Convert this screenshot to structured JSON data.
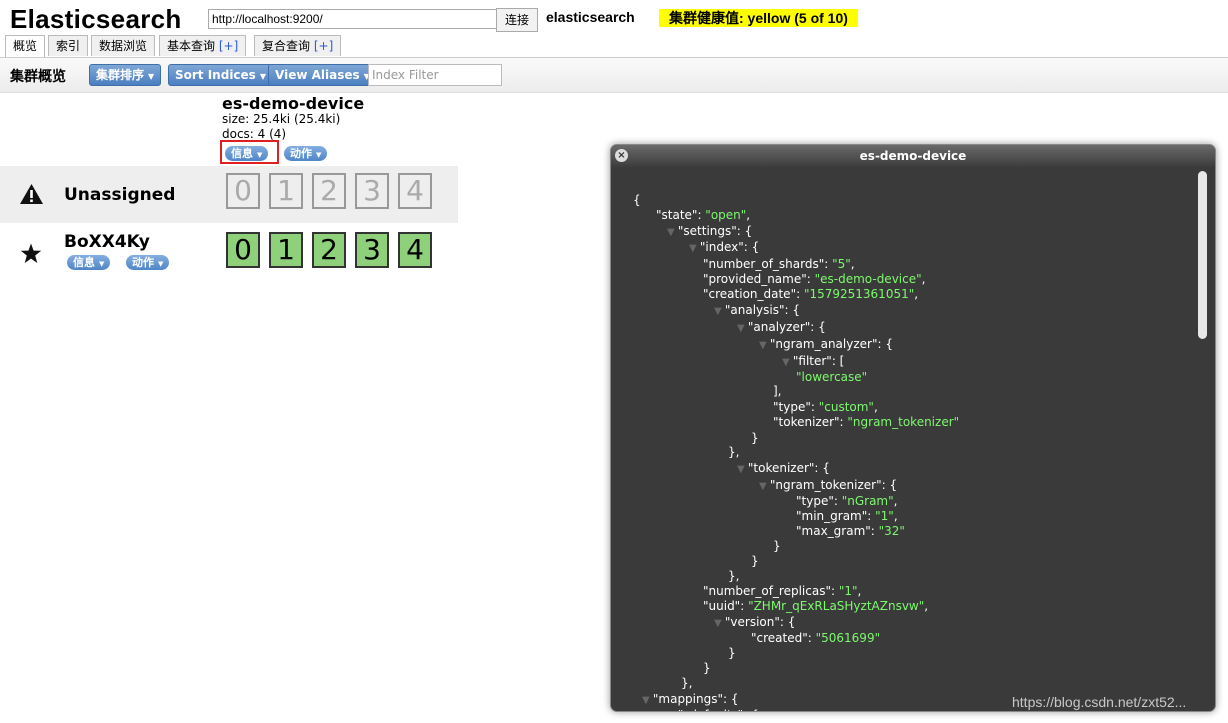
{
  "header": {
    "brand": "Elasticsearch",
    "url_value": "http://localhost:9200/",
    "connect_label": "连接",
    "cluster_name": "elasticsearch",
    "health_text": "集群健康值: yellow (5 of 10)",
    "health_color": "#ffff00"
  },
  "tabs": [
    {
      "label": "概览",
      "plus": ""
    },
    {
      "label": "索引",
      "plus": ""
    },
    {
      "label": "数据浏览",
      "plus": ""
    },
    {
      "label": "基本查询 ",
      "plus": "[+]"
    },
    {
      "label": "复合查询 ",
      "plus": "[+]"
    }
  ],
  "toolbar": {
    "title": "集群概览",
    "sort_cluster_label": "集群排序",
    "sort_indices_label": "Sort Indices",
    "view_aliases_label": "View Aliases",
    "filter_placeholder": "Index Filter"
  },
  "index": {
    "name": "es-demo-device",
    "size": "size: 25.4ki (25.4ki)",
    "docs": "docs: 4 (4)",
    "info_label": "信息",
    "actions_label": "动作"
  },
  "nodes": {
    "unassigned": {
      "label": "Unassigned",
      "shards": [
        "0",
        "1",
        "2",
        "3",
        "4"
      ]
    },
    "node": {
      "label": "BoXX4Ky",
      "info_label": "信息",
      "actions_label": "动作",
      "shards": [
        "0",
        "1",
        "2",
        "3",
        "4"
      ]
    }
  },
  "modal": {
    "title": "es-demo-device",
    "json_lines": [
      {
        "t": "{"
      },
      {
        "k": "\"state\"",
        "v": "\"open\"",
        "e": ","
      },
      {
        "tri": true,
        "k": "\"settings\"",
        "e": ": {"
      },
      {
        "tri": true,
        "k": "\"index\"",
        "e": ": {"
      },
      {
        "k": "\"number_of_shards\"",
        "v": "\"5\"",
        "e": ","
      },
      {
        "k": "\"provided_name\"",
        "v": "\"es-demo-device\"",
        "e": ","
      },
      {
        "k": "\"creation_date\"",
        "v": "\"1579251361051\"",
        "e": ","
      },
      {
        "tri": true,
        "k": "\"analysis\"",
        "e": ": {"
      },
      {
        "tri": true,
        "k": "\"analyzer\"",
        "e": ": {"
      },
      {
        "tri": true,
        "k": "\"ngram_analyzer\"",
        "e": ": {"
      },
      {
        "tri": true,
        "k": "\"filter\"",
        "e": ": ["
      },
      {
        "s": "\"lowercase\""
      },
      {
        "t": "],"
      },
      {
        "k": "\"type\"",
        "v": "\"custom\"",
        "e": ","
      },
      {
        "k": "\"tokenizer\"",
        "v": "\"ngram_tokenizer\"",
        "e": ""
      },
      {
        "t": "}"
      },
      {
        "t": "},"
      },
      {
        "tri": true,
        "k": "\"tokenizer\"",
        "e": ": {"
      },
      {
        "tri": true,
        "k": "\"ngram_tokenizer\"",
        "e": ": {"
      },
      {
        "k": "\"type\"",
        "v": "\"nGram\"",
        "e": ","
      },
      {
        "k": "\"min_gram\"",
        "v": "\"1\"",
        "e": ","
      },
      {
        "k": "\"max_gram\"",
        "v": "\"32\"",
        "e": ""
      },
      {
        "t": "}"
      },
      {
        "t": "}"
      },
      {
        "t": "},"
      },
      {
        "k": "\"number_of_replicas\"",
        "v": "\"1\"",
        "e": ","
      },
      {
        "k": "\"uuid\"",
        "v": "\"ZHMr_qExRLaSHyztAZnsvw\"",
        "e": ","
      },
      {
        "tri": true,
        "k": "\"version\"",
        "e": ": {"
      },
      {
        "k": "\"created\"",
        "v": "\"5061699\"",
        "e": ""
      },
      {
        "t": "}"
      },
      {
        "t": "}"
      },
      {
        "t": "},"
      },
      {
        "tri": true,
        "k": "\"mappings\"",
        "e": ": {"
      },
      {
        "tri": true,
        "k": "\"_default_\"",
        "e": ": {"
      }
    ]
  },
  "watermark": "https://blog.csdn.net/zxt52..."
}
